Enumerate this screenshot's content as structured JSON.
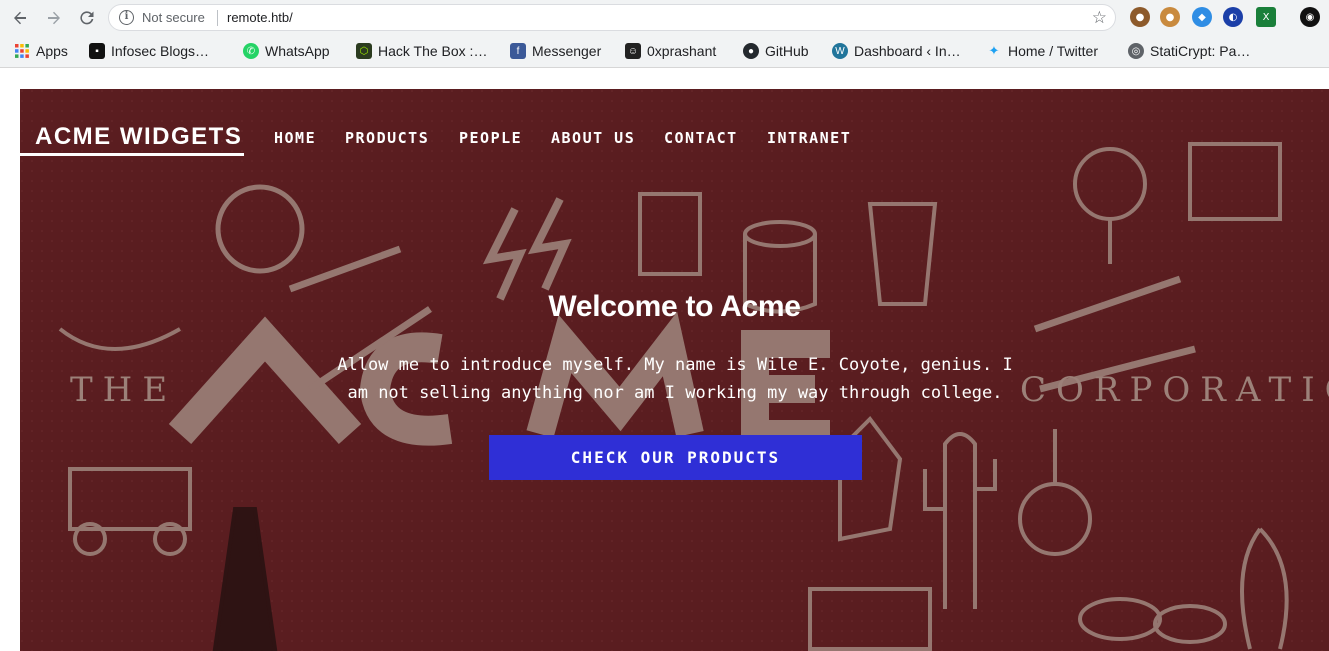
{
  "browser": {
    "security_label": "Not secure",
    "url": "remote.htb/",
    "bookmarks": [
      {
        "label": "Apps",
        "icon": "apps-grid-icon"
      },
      {
        "label": "Infosec Blogs…",
        "icon": "infosec-icon"
      },
      {
        "label": "WhatsApp",
        "icon": "whatsapp-icon"
      },
      {
        "label": "Hack The Box :…",
        "icon": "hackthebox-icon"
      },
      {
        "label": "Messenger",
        "icon": "facebook-icon"
      },
      {
        "label": "0xprashant",
        "icon": "user-icon"
      },
      {
        "label": "GitHub",
        "icon": "github-icon"
      },
      {
        "label": "Dashboard ‹ In…",
        "icon": "wordpress-icon"
      },
      {
        "label": "Home / Twitter",
        "icon": "twitter-icon"
      },
      {
        "label": "StatiCrypt: Pa…",
        "icon": "staticrypt-icon"
      }
    ]
  },
  "site": {
    "brand": "ACME WIDGETS",
    "nav": [
      "HOME",
      "PRODUCTS",
      "PEOPLE",
      "ABOUT US",
      "CONTACT",
      "INTRANET"
    ],
    "hero": {
      "title": "Welcome to Acme",
      "intro_line1": "Allow me to introduce myself. My name is Wile E. Coyote, genius. I",
      "intro_line2": "am not selling anything nor am I working my way through college.",
      "cta": "CHECK OUR PRODUCTS",
      "background_text_left": "THE",
      "background_text_right": "CORPORATION"
    }
  },
  "colors": {
    "hero_bg": "#5a1d20",
    "cta_bg": "#2f2fd6",
    "illustration": "#9c8179"
  }
}
